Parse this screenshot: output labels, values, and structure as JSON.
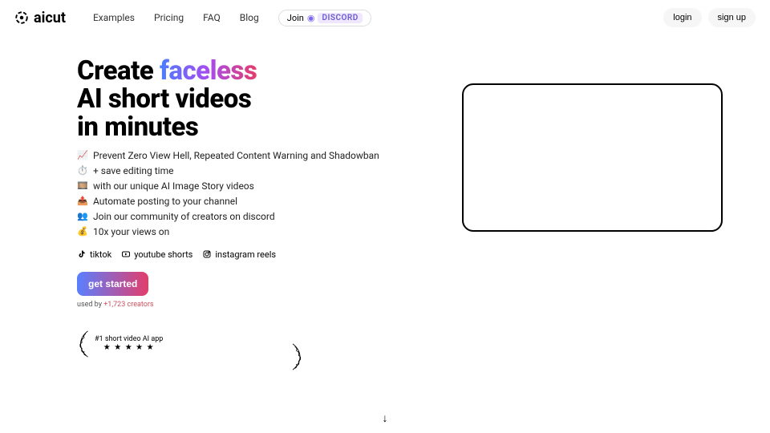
{
  "header": {
    "logo_text": "aicut",
    "nav": [
      "Examples",
      "Pricing",
      "FAQ",
      "Blog"
    ],
    "join_label": "Join",
    "discord_label": "DISCORD",
    "login": "login",
    "signup": "sign up"
  },
  "hero": {
    "title_line1a": "Create ",
    "title_line1b": "faceless",
    "title_line2": "AI short videos",
    "title_line3": "in minutes",
    "features": [
      {
        "emoji": "📈",
        "text": "Prevent Zero View Hell, Repeated Content Warning and Shadowban"
      },
      {
        "emoji": "⏱️",
        "text": "+ save editing time"
      },
      {
        "emoji": "🎞️",
        "text": "with our unique AI Image Story videos"
      },
      {
        "emoji": "📤",
        "text": "Automate posting to your channel"
      },
      {
        "emoji": "👥",
        "text": "Join our community of creators on discord"
      },
      {
        "emoji": "💰",
        "text": "10x your views on"
      }
    ],
    "platforms": [
      {
        "name": "tiktok"
      },
      {
        "name": "youtube shorts"
      },
      {
        "name": "instagram reels"
      }
    ],
    "cta": "get started",
    "used_by_prefix": "used by ",
    "used_by_count": "+1,723 creators",
    "badge_title": "#1 short video AI app",
    "badge_stars": "★ ★ ★ ★ ★"
  },
  "scroll_arrow": "↓"
}
